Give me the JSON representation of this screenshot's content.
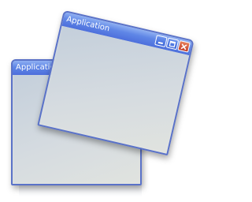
{
  "windows": [
    {
      "title": "Application",
      "controls": [
        "minimize-icon",
        "maximize-icon",
        "close-icon"
      ]
    },
    {
      "title": "Application",
      "controls": []
    }
  ],
  "colors": {
    "title_bar": "#5f86e6",
    "border": "#5a72c8",
    "client": "#d5dbe0",
    "close": "#c4402a"
  }
}
